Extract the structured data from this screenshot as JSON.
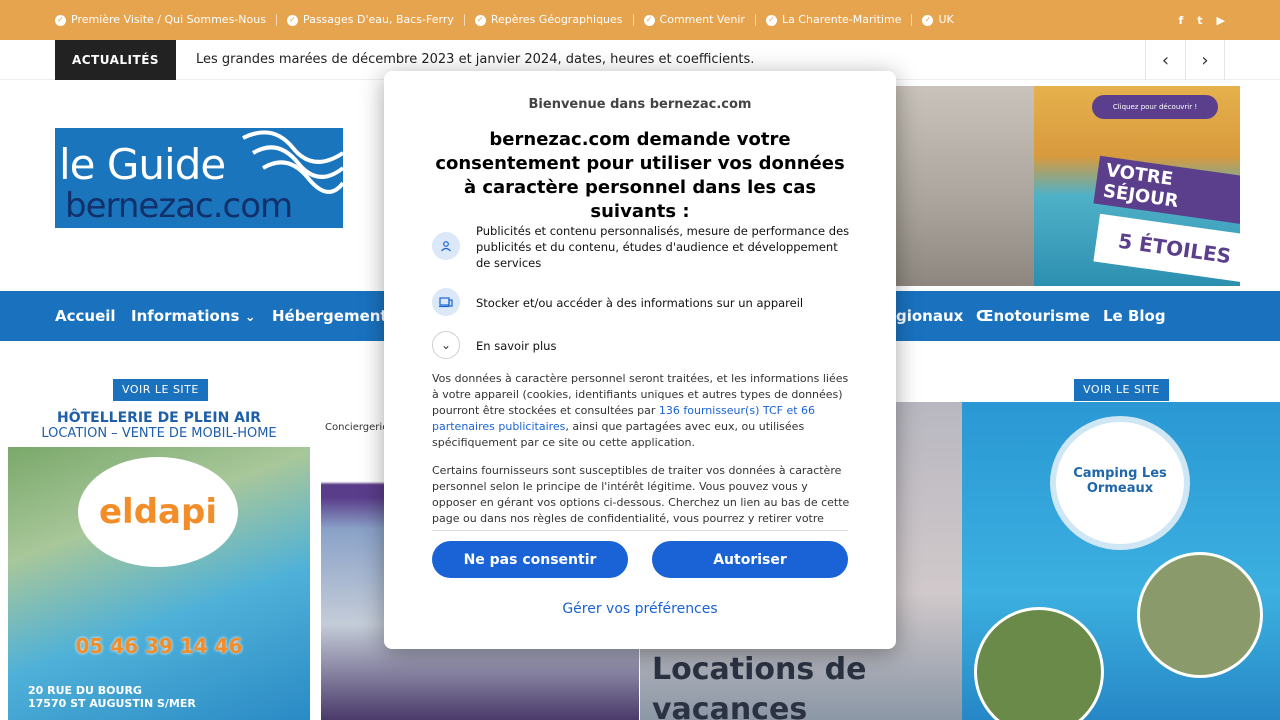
{
  "topbar": {
    "links": [
      "Première Visite / Qui Sommes-Nous",
      "Passages D'eau, Bacs-Ferry",
      "Repères Géographiques",
      "Comment Venir",
      "La Charente-Maritime",
      "UK"
    ],
    "social": {
      "facebook": "f",
      "twitter": "t",
      "youtube": "▶"
    }
  },
  "ticker": {
    "label": "ACTUALITÉS",
    "headline": "Les grandes marées de décembre 2023 et janvier 2024, dates, heures et coefficients.",
    "prev": "‹",
    "next": "›"
  },
  "header": {
    "logo_line1": "le Guide",
    "logo_line2": "bernezac.com",
    "ad": {
      "pill": "Cliquez pour découvrir !",
      "banner1": "VOTRE SÉJOUR",
      "banner2": "5 ÉTOILES"
    }
  },
  "nav": {
    "items": [
      "Accueil",
      "Informations",
      "Hébergement",
      "gionaux",
      "Œnotourisme",
      "Le Blog"
    ],
    "dropdown_icon": "⌄"
  },
  "ads": {
    "see_site": "VOIR LE SITE",
    "card1": {
      "line1": "HÔTELLERIE DE PLEIN AIR",
      "line2": "LOCATION – VENTE DE MOBIL-HOME",
      "brand": "eldapi",
      "phone": "05 46 39 14 46",
      "addr1": "20 RUE DU BOURG",
      "addr2": "17570 ST AUGUSTIN S/MER"
    },
    "card2": {
      "brand": "Conciergerie"
    },
    "card3": {
      "title": "Locations de vacances"
    },
    "card4": {
      "brand": "Camping Les Ormeaux"
    }
  },
  "modal": {
    "welcome": "Bienvenue dans bernezac.com",
    "title": "bernezac.com demande votre consentement pour utiliser vos données à caractère personnel dans les cas suivants :",
    "purposes": [
      {
        "icon": "person-icon",
        "text": "Publicités et contenu personnalisés, mesure de performance des publicités et du contenu, études d'audience et développement de services"
      },
      {
        "icon": "device-icon",
        "text": "Stocker et/ou accéder à des informations sur un appareil"
      }
    ],
    "learn_more": "En savoir plus",
    "para1_a": "Vos données à caractère personnel seront traitées, et les informations liées à votre appareil (cookies, identifiants uniques et autres types de données) pourront être stockées et consultées par ",
    "para1_link": "136 fournisseur(s) TCF et 66 partenaires publicitaires",
    "para1_b": ", ainsi que partagées avec eux, ou utilisées spécifiquement par ce site ou cette application.",
    "para2": "Certains fournisseurs sont susceptibles de traiter vos données à caractère personnel selon le principe de l'intérêt légitime. Vous pouvez vous y opposer en gérant vos options ci-dessous. Cherchez un lien au bas de cette page ou dans nos règles de confidentialité, vous pourrez y retirer votre consentement.",
    "decline": "Ne pas consentir",
    "accept": "Autoriser",
    "manage": "Gérer vos préférences"
  },
  "colors": {
    "topbar": "#e7a44e",
    "nav": "#1a72bf",
    "button": "#1a63d6"
  }
}
